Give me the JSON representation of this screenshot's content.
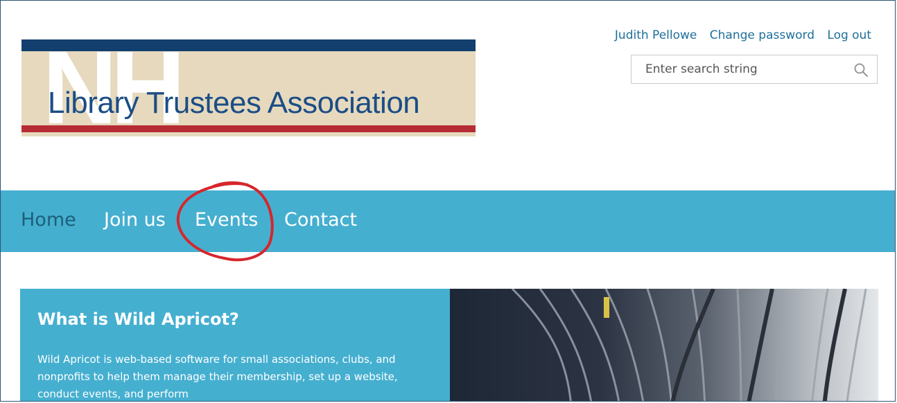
{
  "logo": {
    "initials": "NH",
    "org_name": "Library Trustees Association"
  },
  "user_links": [
    "Judith Pellowe",
    "Change password",
    "Log out"
  ],
  "search": {
    "placeholder": "Enter search string",
    "icon": "magnifier-icon"
  },
  "nav": {
    "items": [
      "Home",
      "Join us",
      "Events",
      "Contact"
    ],
    "active": "Home"
  },
  "annotation": {
    "circled_item": "Events",
    "color": "#d6262c"
  },
  "hero": {
    "title": "What is Wild Apricot?",
    "body": "Wild Apricot is web-based software for small associations, clubs, and nonprofits to help them manage their membership, set up a website, conduct events, and perform"
  },
  "colors": {
    "nav_bg": "#45afd0",
    "link": "#1d6f99",
    "logo_blue": "#123f6e",
    "logo_red": "#b62c35",
    "logo_bg": "#e6d9be"
  }
}
